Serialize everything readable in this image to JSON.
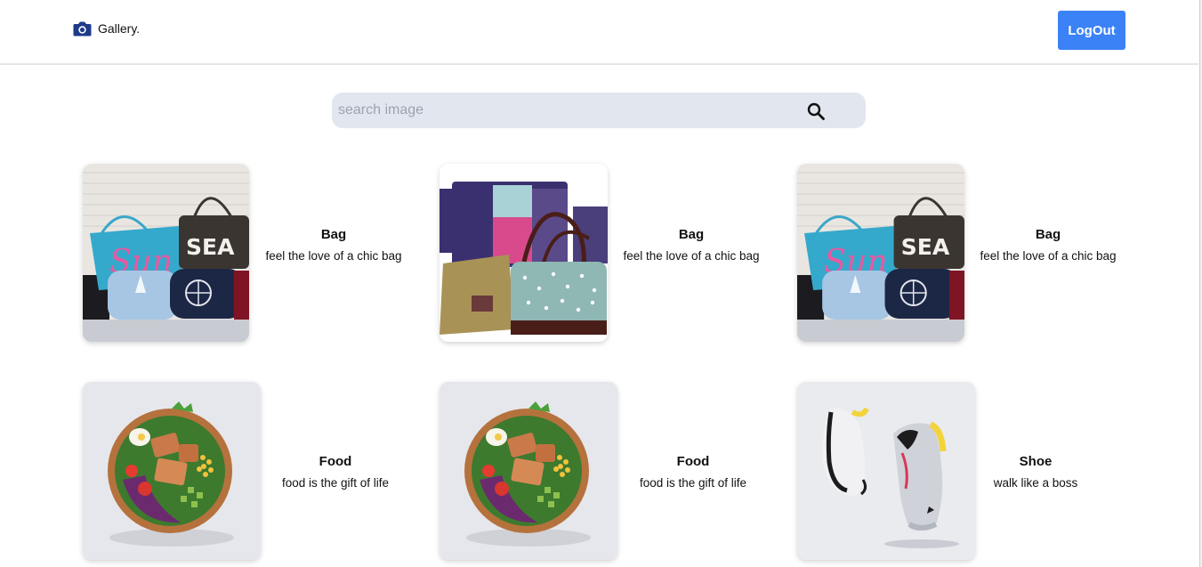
{
  "header": {
    "brand_label": "Gallery.",
    "logout_label": "LogOut"
  },
  "search": {
    "placeholder": "search image",
    "value": ""
  },
  "colors": {
    "accent": "#3b82f6",
    "search_bg": "#e2e7ef",
    "brand_icon": "#1e3a8a"
  },
  "cards": [
    {
      "title": "Bag",
      "desc": "feel the love of a chic bag",
      "image": "bags-sun-sea"
    },
    {
      "title": "Bag",
      "desc": "feel the love of a chic bag",
      "image": "bags-purple-leather"
    },
    {
      "title": "Bag",
      "desc": "feel the love of a chic bag",
      "image": "bags-sun-sea"
    },
    {
      "title": "Food",
      "desc": "food is the gift of life",
      "image": "salad-bowl"
    },
    {
      "title": "Food",
      "desc": "food is the gift of life",
      "image": "salad-bowl"
    },
    {
      "title": "Shoe",
      "desc": "walk like a boss",
      "image": "sneakers"
    }
  ]
}
